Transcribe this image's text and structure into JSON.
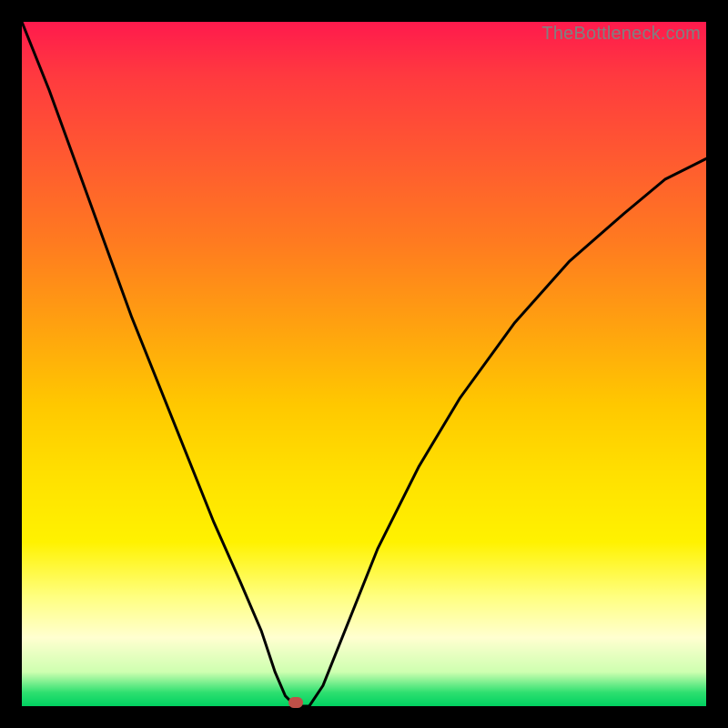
{
  "watermark": "TheBottleneck.com",
  "marker": {
    "color": "#c05048",
    "x_fraction": 0.4,
    "y_fraction": 0.995
  },
  "curve": {
    "stroke": "#000000",
    "stroke_width": 3
  },
  "chart_data": {
    "type": "line",
    "title": "",
    "xlabel": "",
    "ylabel": "",
    "xlim": [
      0,
      1
    ],
    "ylim": [
      0,
      1
    ],
    "grid": false,
    "legend": false,
    "description": "A V-shaped bottleneck curve on a rainbow background. The curve falls steeply from near the top-left corner down to a minimum (sweet spot) near x≈0.40 at the bottom, then rises as a convex curve toward the right edge reaching about y≈0.80 at x=1. High y = high bottleneck (red), low y = optimal (green).",
    "series": [
      {
        "name": "bottleneck-curve",
        "x": [
          0.0,
          0.04,
          0.08,
          0.12,
          0.16,
          0.2,
          0.24,
          0.28,
          0.32,
          0.35,
          0.37,
          0.385,
          0.4,
          0.42,
          0.44,
          0.48,
          0.52,
          0.58,
          0.64,
          0.72,
          0.8,
          0.88,
          0.94,
          1.0
        ],
        "y": [
          1.0,
          0.9,
          0.79,
          0.68,
          0.57,
          0.47,
          0.37,
          0.27,
          0.18,
          0.11,
          0.05,
          0.015,
          0.0,
          0.0,
          0.03,
          0.13,
          0.23,
          0.35,
          0.45,
          0.56,
          0.65,
          0.72,
          0.77,
          0.8
        ]
      }
    ],
    "marker_point": {
      "x": 0.4,
      "y": 0.005
    },
    "background_gradient": {
      "orientation": "vertical",
      "stops": [
        {
          "pos": 0.0,
          "color": "#ff1a4d"
        },
        {
          "pos": 0.32,
          "color": "#ff7a20"
        },
        {
          "pos": 0.56,
          "color": "#ffc800"
        },
        {
          "pos": 0.84,
          "color": "#ffff80"
        },
        {
          "pos": 0.95,
          "color": "#ceffb0"
        },
        {
          "pos": 1.0,
          "color": "#00d060"
        }
      ]
    }
  }
}
